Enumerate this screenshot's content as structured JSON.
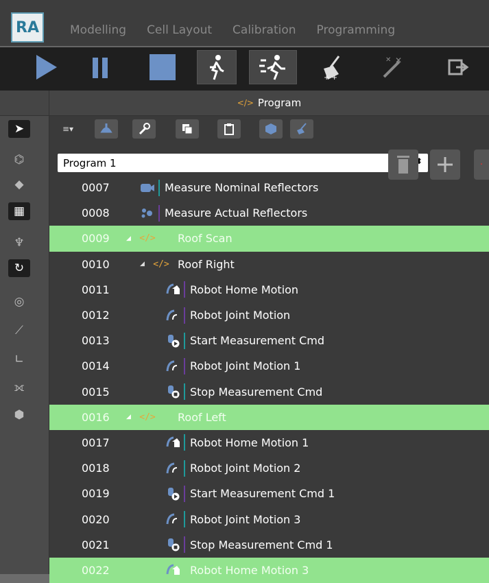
{
  "app": {
    "logo": "RA",
    "accent": "#2a7a9a"
  },
  "tabs": [
    "Modelling",
    "Cell Layout",
    "Calibration",
    "Programming"
  ],
  "toolbar_icons": [
    "play-icon",
    "pause-icon",
    "stop-icon",
    "walk-icon",
    "run-icon",
    "broom-icon",
    "magic-wand-icon",
    "exit-icon"
  ],
  "side_icons": [
    "pointer-icon",
    "tag-icon",
    "cube-arrow-icon",
    "grid-icon",
    "robot-icon",
    "robot-arrow-icon",
    "target-icon",
    "ruler-icon",
    "axes-icon",
    "path-icon",
    "box-settings-icon"
  ],
  "panel": {
    "title": "Program",
    "selected_program": "Program 1"
  },
  "program_toolbar_icons": [
    "list-menu-icon",
    "robot-hand-icon",
    "wrench-icon",
    "copy-icon",
    "paste-icon",
    "cube-icon",
    "broom-icon"
  ],
  "colors": {
    "highlight": "#92e38e",
    "folder": "#e7a63a",
    "teal": "#1f9a9a",
    "purple": "#6a3d9a"
  },
  "rows": [
    {
      "num": "0007",
      "label": "Measure Nominal Reflectors",
      "icon": "camera-icon",
      "indent": 0,
      "bar": "teal",
      "sel": false,
      "expand": false
    },
    {
      "num": "0008",
      "label": "Measure Actual Reflectors",
      "icon": "dots-icon",
      "indent": 0,
      "bar": "purple",
      "sel": false,
      "expand": false
    },
    {
      "num": "0009",
      "label": "Roof Scan",
      "icon": "code-icon",
      "indent": -1,
      "bar": "",
      "sel": true,
      "expand": true
    },
    {
      "num": "0010",
      "label": "Roof Right",
      "icon": "code-icon",
      "indent": 0,
      "bar": "",
      "sel": false,
      "expand": true
    },
    {
      "num": "0011",
      "label": "Robot Home Motion",
      "icon": "home-motion-icon",
      "indent": 1,
      "bar": "purple",
      "sel": false,
      "expand": false
    },
    {
      "num": "0012",
      "label": "Robot Joint Motion",
      "icon": "joint-motion-icon",
      "indent": 1,
      "bar": "purple",
      "sel": false,
      "expand": false
    },
    {
      "num": "0013",
      "label": "Start Measurement Cmd",
      "icon": "measure-start-icon",
      "indent": 1,
      "bar": "teal",
      "sel": false,
      "expand": false
    },
    {
      "num": "0014",
      "label": "Robot Joint Motion 1",
      "icon": "joint-motion-icon",
      "indent": 1,
      "bar": "purple",
      "sel": false,
      "expand": false
    },
    {
      "num": "0015",
      "label": "Stop Measurement Cmd",
      "icon": "measure-stop-icon",
      "indent": 1,
      "bar": "teal",
      "sel": false,
      "expand": false
    },
    {
      "num": "0016",
      "label": "Roof Left",
      "icon": "code-icon",
      "indent": -1,
      "bar": "",
      "sel": true,
      "expand": true
    },
    {
      "num": "0017",
      "label": "Robot Home Motion 1",
      "icon": "home-motion-icon",
      "indent": 1,
      "bar": "teal",
      "sel": false,
      "expand": false
    },
    {
      "num": "0018",
      "label": "Robot Joint Motion 2",
      "icon": "joint-motion-icon",
      "indent": 1,
      "bar": "teal",
      "sel": false,
      "expand": false
    },
    {
      "num": "0019",
      "label": "Start Measurement Cmd 1",
      "icon": "measure-start-icon",
      "indent": 1,
      "bar": "purple",
      "sel": false,
      "expand": false
    },
    {
      "num": "0020",
      "label": "Robot Joint Motion 3",
      "icon": "joint-motion-icon",
      "indent": 1,
      "bar": "teal",
      "sel": false,
      "expand": false
    },
    {
      "num": "0021",
      "label": "Stop Measurement Cmd 1",
      "icon": "measure-stop-icon",
      "indent": 1,
      "bar": "purple",
      "sel": false,
      "expand": false
    },
    {
      "num": "0022",
      "label": "Robot Home Motion 3",
      "icon": "home-motion-icon",
      "indent": 1,
      "bar": "",
      "sel": true,
      "expand": false
    }
  ]
}
